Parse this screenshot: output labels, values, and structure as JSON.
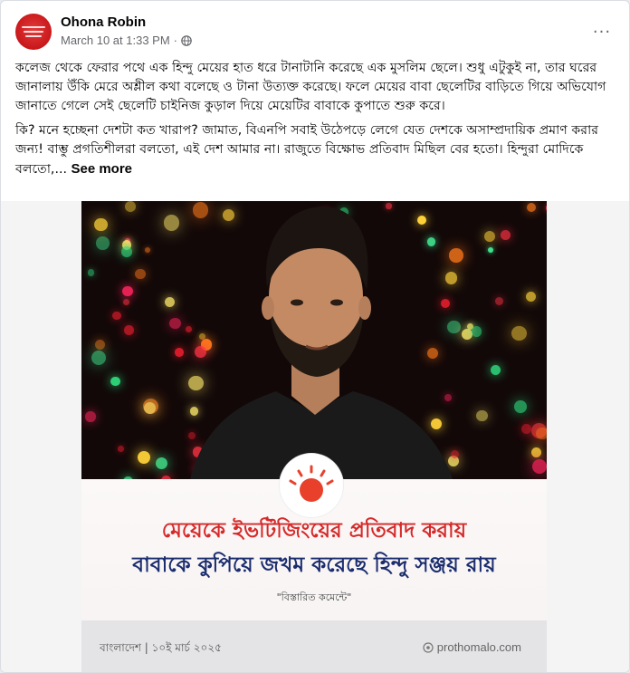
{
  "post": {
    "author": "Ohona Robin",
    "timestamp": "March 10 at 1:33 PM",
    "separator": "·",
    "privacy_icon": "globe-icon",
    "more_label": "···",
    "paragraph1": "কলেজ থেকে ফেরার পথে এক হিন্দু মেয়ের হাত ধরে টানাটানি করেছে এক মুসলিম ছেলে। শুধু এটুকুই না, তার ঘরের জানালায় উঁকি মেরে অশ্লীল কথা বলেছে ও টানা উত্যক্ত করেছে। ফলে মেয়ের বাবা ছেলেটির বাড়িতে গিয়ে অভিযোগ জানাতে গেলে সেই ছেলেটি চাইনিজ কুড়াল দিয়ে মেয়েটির বাবাকে কুপাতে শুরু করে।",
    "paragraph2": "কি? মনে হচ্ছেনা দেশটা কত খারাপ? জামাত, বিএনপি সবাই উঠেপড়ে লেগে যেত দেশকে অসাম্প্রদায়িক প্রমাণ করার জন্য! বাম্ভু প্রগতিশীলরা বলতো, এই দেশ আমার না। রাজুতে বিক্ষোভ প্রতিবাদ মিছিল বের হতো। হিন্দুরা মোদিকে বলতো,...",
    "see_more": "See more"
  },
  "news_card": {
    "headline_line1": "মেয়েকে ইভটিজিংয়ের প্রতিবাদ করায়",
    "headline_line2": "বাবাকে কুপিয়ে জখম করেছে হিন্দু সঞ্জয় রায়",
    "details_note": "\"বিস্তারিত কমেন্টে\"",
    "dateline": "বাংলাদেশ | ১০ই মার্চ ২০২৫",
    "source": "prothomalo.com",
    "headline1_color": "#d62a2a",
    "headline2_color": "#1b2d6e",
    "logo_color": "#e8402a"
  }
}
